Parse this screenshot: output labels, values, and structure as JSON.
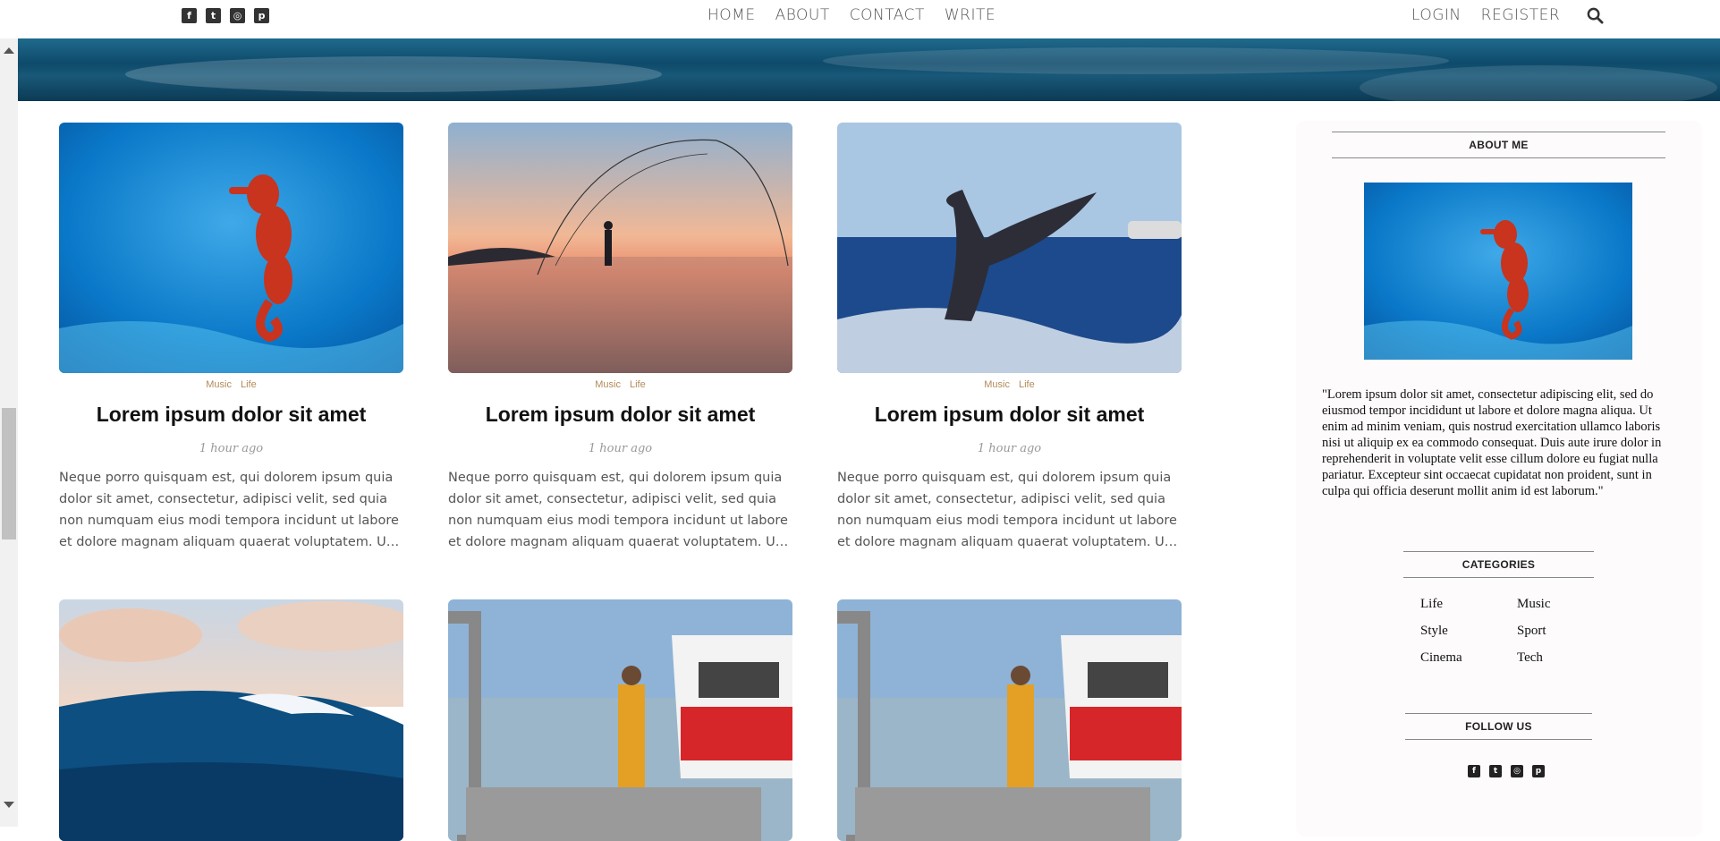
{
  "social": [
    {
      "icon": "facebook-icon",
      "glyph": "f"
    },
    {
      "icon": "twitter-icon",
      "glyph": "t"
    },
    {
      "icon": "instagram-icon",
      "glyph": "◎"
    },
    {
      "icon": "pinterest-icon",
      "glyph": "p"
    }
  ],
  "nav": {
    "links": [
      "HOME",
      "ABOUT",
      "CONTACT",
      "WRITE"
    ],
    "login": "LOGIN",
    "register": "REGISTER"
  },
  "colors": {
    "category": "#b38a58",
    "accent_dark": "#222222"
  },
  "posts": [
    {
      "image": "seahorse",
      "categories": [
        "Music",
        "Life"
      ],
      "title": "Lorem ipsum dolor sit amet",
      "date": "1 hour ago",
      "desc": "Neque porro quisquam est, qui dolorem ipsum quia dolor sit amet, consectetur, adipisci velit, sed quia non numquam eius modi tempora incidunt ut labore et dolore magnam aliquam quaerat voluptatem. Ut enim ad minima veniam"
    },
    {
      "image": "fisherman-sunset",
      "categories": [
        "Music",
        "Life"
      ],
      "title": "Lorem ipsum dolor sit amet",
      "date": "1 hour ago",
      "desc": "Neque porro quisquam est, qui dolorem ipsum quia dolor sit amet, consectetur, adipisci velit, sed quia non numquam eius modi tempora incidunt ut labore et dolore magnam aliquam quaerat voluptatem. Ut enim ad minima veniam"
    },
    {
      "image": "whale-tail",
      "categories": [
        "Music",
        "Life"
      ],
      "title": "Lorem ipsum dolor sit amet",
      "date": "1 hour ago",
      "desc": "Neque porro quisquam est, qui dolorem ipsum quia dolor sit amet, consectetur, adipisci velit, sed quia non numquam eius modi tempora incidunt ut labore et dolore magnam aliquam quaerat voluptatem. Ut enim ad minima veniam"
    },
    {
      "image": "ocean-wave"
    },
    {
      "image": "fishing-boat"
    },
    {
      "image": "fishing-boat"
    }
  ],
  "sidebar": {
    "about_title": "ABOUT ME",
    "about_text": "\"Lorem ipsum dolor sit amet, consectetur adipiscing elit, sed do eiusmod tempor incididunt ut labore et dolore magna aliqua. Ut enim ad minim veniam, quis nostrud exercitation ullamco laboris nisi ut aliquip ex ea commodo consequat. Duis aute irure dolor in reprehenderit in voluptate velit esse cillum dolore eu fugiat nulla pariatur. Excepteur sint occaecat cupidatat non proident, sunt in culpa qui officia deserunt mollit anim id est laborum.\"",
    "categories_title": "CATEGORIES",
    "categories": [
      "Life",
      "Music",
      "Style",
      "Sport",
      "Cinema",
      "Tech"
    ],
    "follow_title": "FOLLOW US"
  }
}
